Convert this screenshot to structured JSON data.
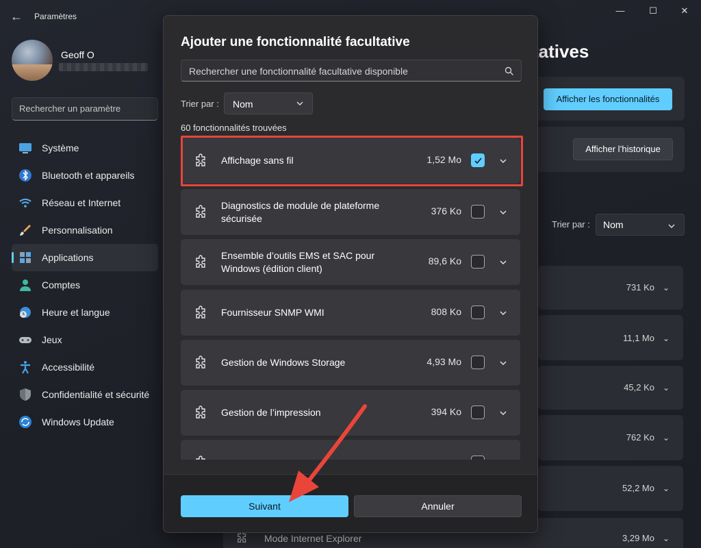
{
  "window": {
    "title": "Paramètres",
    "back_glyph": "←",
    "min_glyph": "—",
    "max_glyph": "☐",
    "close_glyph": "✕"
  },
  "profile": {
    "name": "Geoff O"
  },
  "search": {
    "placeholder": "Rechercher un paramètre"
  },
  "nav": {
    "items": [
      {
        "label": "Système",
        "icon": "monitor-icon"
      },
      {
        "label": "Bluetooth et appareils",
        "icon": "bluetooth-icon"
      },
      {
        "label": "Réseau et Internet",
        "icon": "wifi-icon"
      },
      {
        "label": "Personnalisation",
        "icon": "brush-icon"
      },
      {
        "label": "Applications",
        "icon": "apps-icon",
        "active": true
      },
      {
        "label": "Comptes",
        "icon": "person-icon"
      },
      {
        "label": "Heure et langue",
        "icon": "globe-clock-icon"
      },
      {
        "label": "Jeux",
        "icon": "gamepad-icon"
      },
      {
        "label": "Accessibilité",
        "icon": "accessibility-icon"
      },
      {
        "label": "Confidentialité et sécurité",
        "icon": "shield-icon"
      },
      {
        "label": "Windows Update",
        "icon": "update-icon"
      }
    ]
  },
  "background": {
    "heading": "tatives",
    "show_features_button": "Afficher les fonctionnalités",
    "show_history_button": "Afficher l’historique",
    "sort_label": "Trier par :",
    "sort_value": "Nom",
    "rows": [
      {
        "size": "731 Ko"
      },
      {
        "size": "11,1 Mo"
      },
      {
        "size": "45,2 Ko"
      },
      {
        "size": "762 Ko"
      },
      {
        "size": "52,2 Mo"
      },
      {
        "size": "3,29 Mo",
        "label": "Mode Internet Explorer"
      }
    ]
  },
  "dialog": {
    "title": "Ajouter une fonctionnalité facultative",
    "search_placeholder": "Rechercher une fonctionnalité facultative disponible",
    "sort_label": "Trier par :",
    "sort_value": "Nom",
    "count": "60 fonctionnalités trouvées",
    "items": [
      {
        "name": "Affichage sans fil",
        "size": "1,52 Mo",
        "checked": true
      },
      {
        "name": "Diagnostics de module de plateforme sécurisée",
        "size": "376 Ko",
        "checked": false
      },
      {
        "name": "Ensemble d’outils EMS et SAC pour Windows (édition client)",
        "size": "89,6 Ko",
        "checked": false
      },
      {
        "name": "Fournisseur SNMP WMI",
        "size": "808 Ko",
        "checked": false
      },
      {
        "name": "Gestion de Windows Storage",
        "size": "4,93 Mo",
        "checked": false
      },
      {
        "name": "Gestion de l’impression",
        "size": "394 Ko",
        "checked": false
      }
    ],
    "next_button": "Suivant",
    "cancel_button": "Annuler"
  },
  "colors": {
    "accent": "#60cdff",
    "highlight": "#e9453a"
  }
}
